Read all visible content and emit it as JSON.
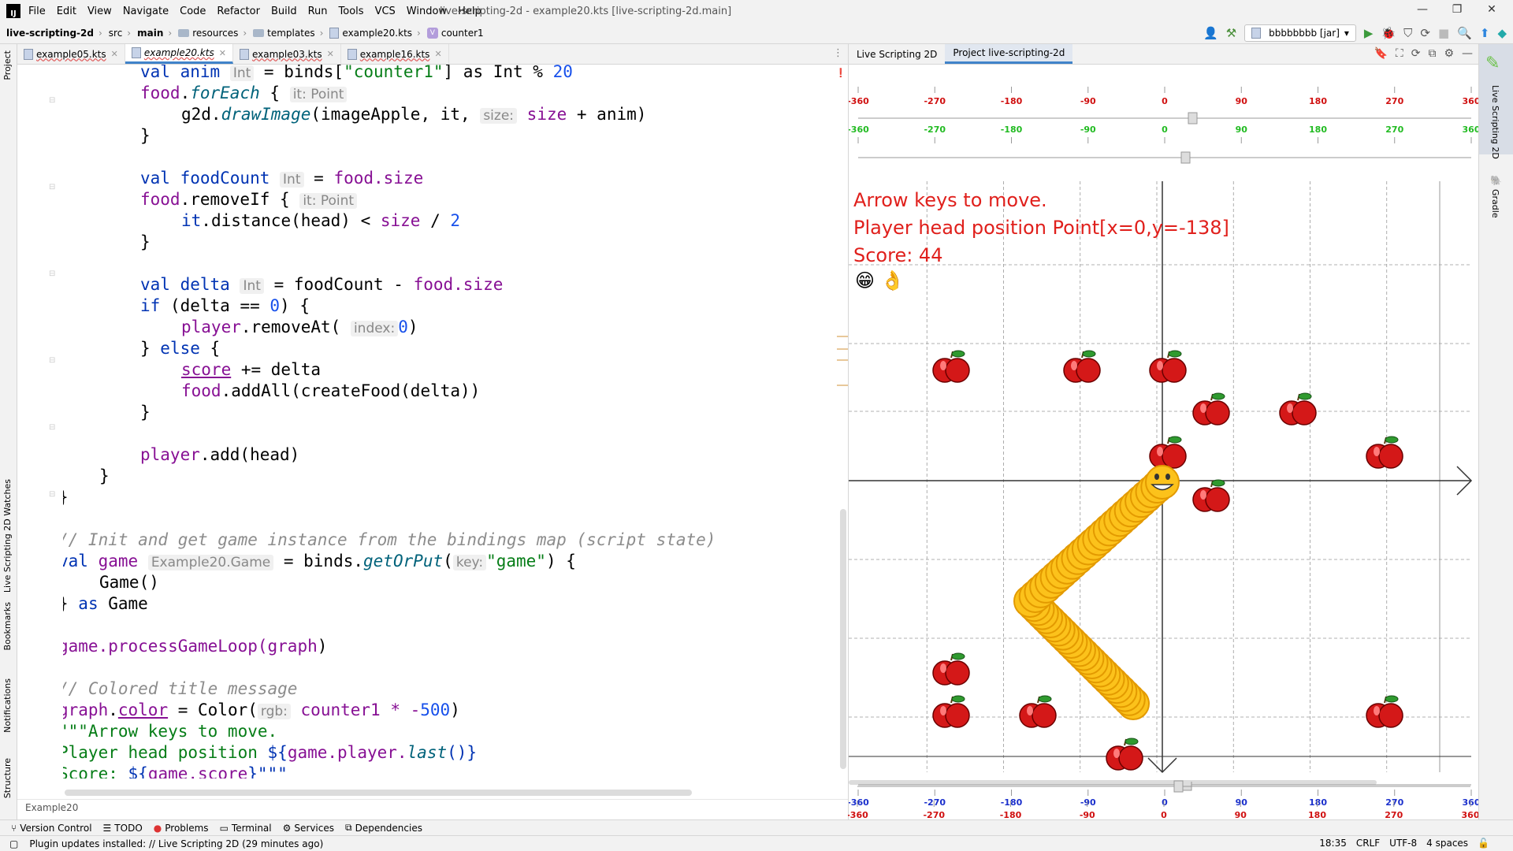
{
  "menu": [
    "File",
    "Edit",
    "View",
    "Navigate",
    "Code",
    "Refactor",
    "Build",
    "Run",
    "Tools",
    "VCS",
    "Window",
    "Help"
  ],
  "window_title": "live-scripting-2d - example20.kts [live-scripting-2d.main]",
  "breadcrumbs": [
    "live-scripting-2d",
    "src",
    "main",
    "resources",
    "templates",
    "example20.kts",
    "counter1"
  ],
  "run_config": "bbbbbbbb [jar]",
  "editor_tabs": [
    {
      "label": "example05.kts",
      "active": false
    },
    {
      "label": "example20.kts",
      "active": true
    },
    {
      "label": "example03.kts",
      "active": false
    },
    {
      "label": "example16.kts",
      "active": false
    }
  ],
  "code": {
    "l1_anim": "val anim",
    "l1_hint": "Int",
    "l1_rest_a": " = binds[",
    "l1_str": "\"counter1\"",
    "l1_rest_b": "] as Int % ",
    "l1_num": "20",
    "l2_food": "food",
    "l2_fe": "forEach",
    "l2_hint": "it: Point",
    "l3_a": "g2d.",
    "l3_fn": "drawImage",
    "l3_b": "(imageApple, it,",
    "l3_hint": "size:",
    "l3_c": " size",
    "l3_d": " + anim)",
    "l4": "}",
    "l5_a": "val foodCount",
    "l5_hint": "Int",
    "l5_b": " = ",
    "l5_c": "food.size",
    "l6_a": "food",
    "l6_b": ".removeIf {",
    "l6_hint": "it: Point",
    "l7_a": "it",
    "l7_b": ".distance(head) < ",
    "l7_c": "size",
    "l7_d": " / ",
    "l7_e": "2",
    "l8": "}",
    "l9_a": "val delta",
    "l9_hint": "Int",
    "l9_b": " = foodCount - ",
    "l9_c": "food.size",
    "l10_a": "if",
    "l10_b": " (delta == ",
    "l10_c": "0",
    "l10_d": ") {",
    "l11_a": "player",
    "l11_b": ".removeAt(",
    "l11_hint": "index:",
    "l11_c": "0",
    "l11_d": ")",
    "l12_a": "} ",
    "l12_b": "else",
    "l12_c": " {",
    "l13_a": "score",
    "l13_b": " += delta",
    "l14_a": "food",
    "l14_b": ".addAll(createFood(delta))",
    "l15": "}",
    "l16_a": "player",
    "l16_b": ".add(head)",
    "l17": "}",
    "l18": "}",
    "l19": "// Init and get game instance from the bindings map (script state)",
    "l20_a": "val",
    "l20_b": " game",
    "l20_hint": "Example20.Game",
    "l20_c": " = binds.",
    "l20_fn": "getOrPut",
    "l20_d": "(",
    "l20_hint2": "key:",
    "l20_str": "\"game\"",
    "l20_e": ") {",
    "l21": "Game()",
    "l22_a": "} ",
    "l22_b": "as",
    "l22_c": " Game",
    "l23_a": "game.processGameLoop(",
    "l23_b": "graph",
    "l23_c": ")",
    "l24": "// Colored title message",
    "l25_a": "graph",
    "l25_b": ".",
    "l25_c": "color",
    "l25_d": " = Color(",
    "l25_hint": "rgb:",
    "l25_e": " counter1 * -",
    "l25_f": "500",
    "l25_g": ")",
    "l26": "\"\"\"Arrow keys to move.",
    "l27_a": "Player head position ",
    "l27_b": "${",
    "l27_c": "game.player.",
    "l27_d": "last",
    "l27_e": "()}",
    "l28_a": "Score: ",
    "l28_b": "${",
    "l28_c": "game.",
    "l28_d": "score",
    "l28_e": "}\"\"\""
  },
  "editor_footer": "Example20",
  "panel_tabs": [
    "Live Scripting 2D",
    "Project live-scripting-2d"
  ],
  "right_stripe": [
    "Live Scripting 2D",
    "Gradle"
  ],
  "left_stripe": [
    "Project",
    "Live Scripting 2D Watches",
    "Bookmarks",
    "Notifications",
    "Structure"
  ],
  "ruler_ticks": [
    "-360",
    "-270",
    "-180",
    "-90",
    "0",
    "90",
    "180",
    "270",
    "360"
  ],
  "game_text": {
    "line1": "Arrow keys to move.",
    "line2": "Player head position Point[x=0,y=-138]",
    "line3": "Score: 44",
    "emoji": "😁 👌"
  },
  "bottom_tools": [
    "Version Control",
    "TODO",
    "Problems",
    "Terminal",
    "Services",
    "Dependencies"
  ],
  "status": {
    "message": "Plugin updates installed: // Live Scripting 2D (29 minutes ago)",
    "position": "18:35",
    "line_sep": "CRLF",
    "encoding": "UTF-8",
    "indent": "4 spaces"
  },
  "colors": {
    "accent": "#4083c9",
    "game_text": "#e0201c",
    "ruler_red": "#d01010",
    "ruler_blue": "#1a2fcc",
    "ruler_green": "#22bb22"
  }
}
